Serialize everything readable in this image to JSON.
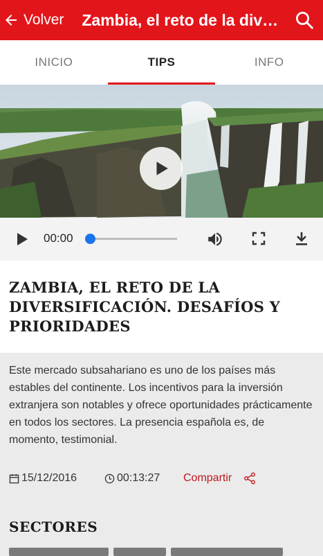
{
  "appbar": {
    "back_label": "Volver",
    "title": "Zambia, el reto de la dive..."
  },
  "tabs": [
    {
      "label": "INICIO",
      "active": false
    },
    {
      "label": "TIPS",
      "active": true
    },
    {
      "label": "INFO",
      "active": false
    }
  ],
  "player": {
    "time": "00:00",
    "progress": 0
  },
  "article": {
    "headline": "ZAMBIA, EL RETO DE LA DIVERSIFICACIÓN. DESAFÍOS Y PRIORIDADES",
    "description": "Este mercado subsahariano es uno de los países más estables del continente. Los incentivos para la inversión extranjera son notables y ofrece oportunidades prácticamente en todos los sectores. La presencia española es, de momento, testimonial.",
    "date": "15/12/2016",
    "duration": "00:13:27",
    "share_label": "Compartir"
  },
  "sectors": {
    "heading": "SECTORES"
  },
  "colors": {
    "accent": "#e2151b",
    "share": "#c0181d",
    "knob": "#1a73e8"
  },
  "icons": [
    "arrow-left-icon",
    "search-icon",
    "play-icon",
    "volume-icon",
    "fullscreen-icon",
    "download-icon",
    "calendar-icon",
    "clock-icon",
    "share-icon"
  ]
}
